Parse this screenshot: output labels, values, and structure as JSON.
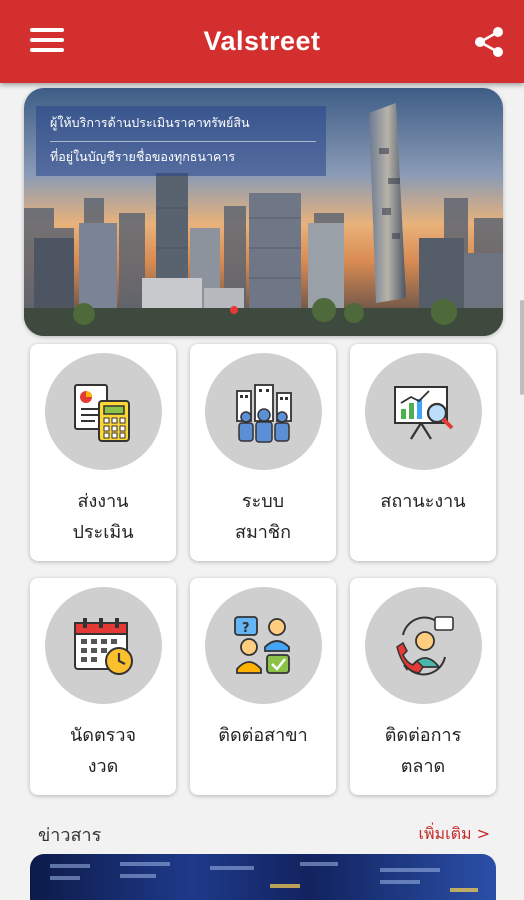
{
  "app": {
    "title": "Valstreet"
  },
  "appbar": {
    "menu_icon": "hamburger-menu-icon",
    "share_icon": "share-icon"
  },
  "banner": {
    "line1": "ผู้ให้บริการด้านประเมินราคาทรัพย์สิน",
    "line2": "ที่อยู่ในบัญชีรายชื่อของทุกธนาคาร"
  },
  "menu": [
    {
      "label": "ส่งงาน\nประเมิน",
      "icon": "calculator-documents-icon"
    },
    {
      "label": "ระบบ\nสมาชิก",
      "icon": "members-group-icon"
    },
    {
      "label": "สถานะงาน",
      "icon": "presentation-chart-search-icon"
    },
    {
      "label": "นัดตรวจ\nงวด",
      "icon": "calendar-clock-icon"
    },
    {
      "label": "ติดต่อสาขา",
      "icon": "contact-people-icon"
    },
    {
      "label": "ติดต่อการ\nตลาด",
      "icon": "call-support-icon"
    }
  ],
  "news": {
    "title": "ข่าวสาร",
    "more": "เพิ่มเติม >"
  },
  "colors": {
    "primary": "#d32f2f",
    "icon_bg": "#cfcfcf",
    "link": "#c62828"
  }
}
